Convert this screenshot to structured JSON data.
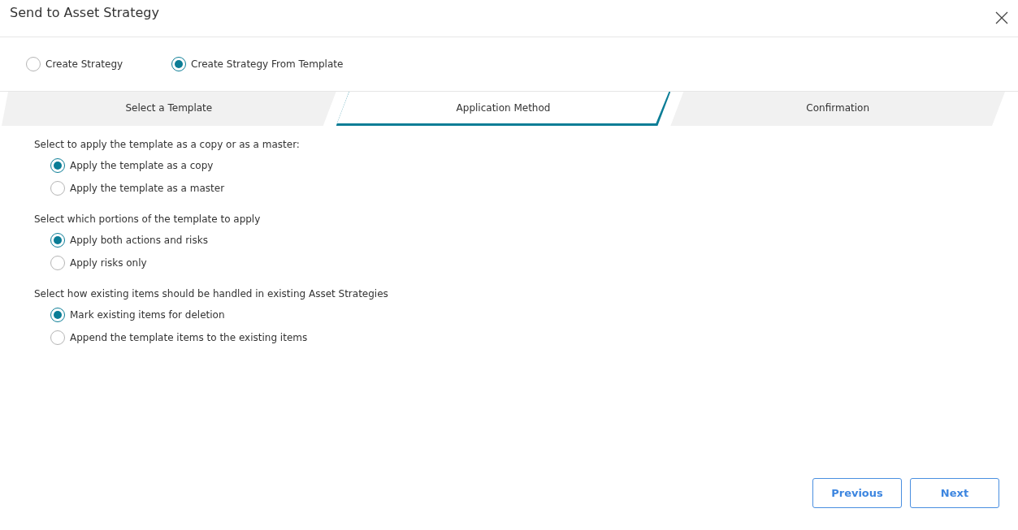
{
  "window": {
    "title": "Send to Asset Strategy"
  },
  "mode_options": [
    {
      "label": "Create Strategy",
      "selected": false
    },
    {
      "label": "Create Strategy From Template",
      "selected": true
    }
  ],
  "steps": [
    {
      "label": "Select a Template",
      "selected": false
    },
    {
      "label": "Application Method",
      "selected": true
    },
    {
      "label": "Confirmation",
      "selected": false
    }
  ],
  "groups": [
    {
      "prompt": "Select to apply the template as a copy or as a master:",
      "options": [
        {
          "label": "Apply the template as a copy",
          "selected": true
        },
        {
          "label": "Apply the template as a master",
          "selected": false
        }
      ]
    },
    {
      "prompt": "Select which portions of the template to apply",
      "options": [
        {
          "label": "Apply both actions and risks",
          "selected": true
        },
        {
          "label": "Apply risks only",
          "selected": false
        }
      ]
    },
    {
      "prompt": "Select how existing items should be handled in existing Asset Strategies",
      "options": [
        {
          "label": "Mark existing items for deletion",
          "selected": true
        },
        {
          "label": "Append the template items to the existing items",
          "selected": false
        }
      ]
    }
  ],
  "buttons": [
    "Previous",
    "Next"
  ]
}
